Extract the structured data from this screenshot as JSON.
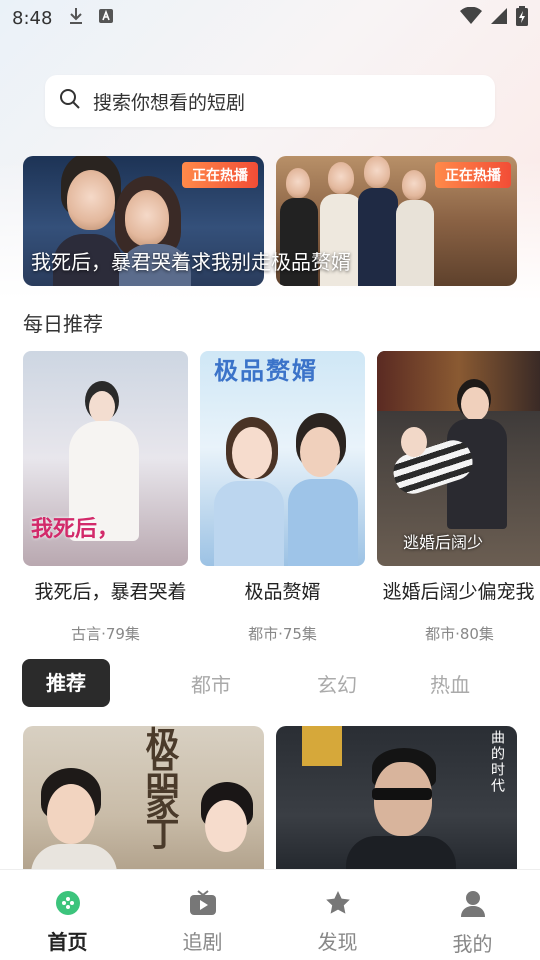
{
  "status_bar": {
    "time": "8:48",
    "icons": [
      "download-icon",
      "a-badge-icon",
      "wifi-icon",
      "signal-icon",
      "battery-icon"
    ]
  },
  "search": {
    "placeholder": "搜索你想看的短剧"
  },
  "banners": [
    {
      "tag": "正在热播"
    },
    {
      "tag": "正在热播"
    }
  ],
  "banner_caption": "我死后，暴君哭着求我别走极品赘婿",
  "daily": {
    "title": "每日推荐",
    "items": [
      {
        "name": "我死后，暴君哭着",
        "meta": "古言·79集",
        "poster_text": "我死后，"
      },
      {
        "name": "极品赘婿",
        "meta": "都市·75集",
        "poster_text": "极品赘婿"
      },
      {
        "name": "逃婚后阔少偏宠我",
        "meta": "都市·80集",
        "poster_text": "逃婚后阔少"
      }
    ]
  },
  "tabs": [
    {
      "label": "推荐",
      "active": true
    },
    {
      "label": "都市",
      "active": false
    },
    {
      "label": "玄幻",
      "active": false
    },
    {
      "label": "热血",
      "active": false
    }
  ],
  "grid_posters": [
    {
      "text": "极品家丁"
    },
    {
      "text": "曲的时代"
    }
  ],
  "nav": [
    {
      "label": "首页",
      "icon": "home-game-icon",
      "active": true
    },
    {
      "label": "追剧",
      "icon": "tv-play-icon",
      "active": false
    },
    {
      "label": "发现",
      "icon": "star-icon",
      "active": false
    },
    {
      "label": "我的",
      "icon": "user-icon",
      "active": false
    }
  ],
  "colors": {
    "accent_green": "#3cc47c",
    "tag_orange": "#f24d36",
    "active_tab_bg": "#2b2b2b"
  }
}
